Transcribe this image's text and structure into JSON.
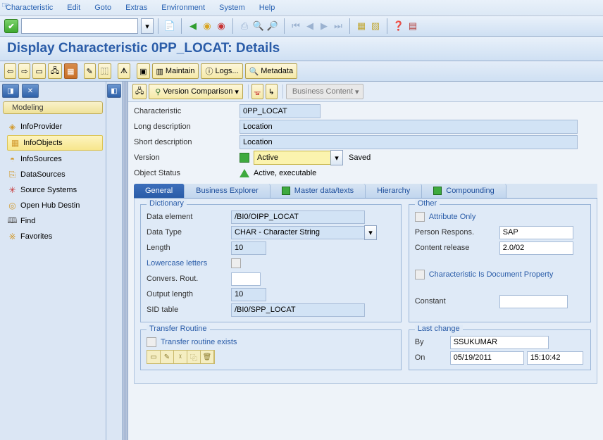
{
  "menu": [
    "Characteristic",
    "Edit",
    "Goto",
    "Extras",
    "Environment",
    "System",
    "Help"
  ],
  "title": "Display Characteristic 0PP_LOCAT: Details",
  "apptoolbar": {
    "maintain": "Maintain",
    "logs": "Logs...",
    "metadata": "Metadata"
  },
  "objtoolbar": {
    "version_compare": "Version Comparison",
    "business_content": "Business Content"
  },
  "sidebar": {
    "head": "Modeling",
    "items": [
      {
        "label": "InfoProvider",
        "icon": "◈"
      },
      {
        "label": "InfoObjects",
        "icon": "▦"
      },
      {
        "label": "InfoSources",
        "icon": "◓"
      },
      {
        "label": "DataSources",
        "icon": "⎘"
      },
      {
        "label": "Source Systems",
        "icon": "✳"
      },
      {
        "label": "Open Hub Destin",
        "icon": "◎"
      },
      {
        "label": "Find",
        "icon": "🔍"
      },
      {
        "label": "Favorites",
        "icon": "※"
      }
    ]
  },
  "header_form": {
    "char_label": "Characteristic",
    "char_value": "0PP_LOCAT",
    "ldesc_label": "Long description",
    "ldesc_value": "Location",
    "sdesc_label": "Short description",
    "sdesc_value": "Location",
    "ver_label": "Version",
    "ver_value": "Active",
    "ver_status": "Saved",
    "ostat_label": "Object Status",
    "ostat_value": "Active, executable"
  },
  "tabs": [
    "General",
    "Business Explorer",
    "Master data/texts",
    "Hierarchy",
    "Compounding"
  ],
  "dictionary": {
    "legend": "Dictionary",
    "data_element_label": "Data element",
    "data_element": "/BI0/OIPP_LOCAT",
    "data_type_label": "Data Type",
    "data_type": "CHAR - Character String",
    "length_label": "Length",
    "length": "10",
    "lowercase_label": "Lowercase letters",
    "convers_label": "Convers. Rout.",
    "output_len_label": "Output length",
    "output_len": "10",
    "sid_label": "SID table",
    "sid": "/BI0/SPP_LOCAT"
  },
  "other": {
    "legend": "Other",
    "attr_only_label": "Attribute Only",
    "person_label": "Person Respons.",
    "person": "SAP",
    "release_label": "Content release",
    "release": "2.0/02",
    "docprop_label": "Characteristic Is Document Property",
    "constant_label": "Constant"
  },
  "transfer": {
    "legend": "Transfer Routine",
    "exists_label": "Transfer routine exists"
  },
  "lastchange": {
    "legend": "Last change",
    "by_label": "By",
    "by": "SSUKUMAR",
    "on_label": "On",
    "on_date": "05/19/2011",
    "on_time": "15:10:42"
  }
}
